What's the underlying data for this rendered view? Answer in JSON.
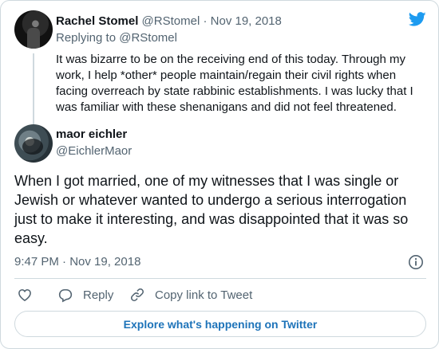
{
  "parent_tweet": {
    "author_name": "Rachel Stomel",
    "author_handle": "@RStomel",
    "separator": "·",
    "date": "Nov 19, 2018",
    "replying_to": "Replying to @RStomel",
    "text": "It was bizarre to be on the receiving end of this today. Through my work, I help *other* people maintain/regain their civil rights when facing overreach by state rabbinic establishments. I was lucky that I was familiar with these shenanigans and did not feel threatened."
  },
  "tweet": {
    "author_name": "maor eichler",
    "author_handle": "@EichlerMaor",
    "text": "When I got married, one of my witnesses that I was single or Jewish or whatever wanted to undergo a serious interrogation just to make it interesting, and was disappointed that it was so easy.",
    "timestamp": "9:47 PM · Nov 19, 2018"
  },
  "actions": {
    "like_icon": "heart-icon",
    "reply_label": "Reply",
    "copy_label": "Copy link to Tweet"
  },
  "explore_button": "Explore what's happening on Twitter",
  "colors": {
    "twitter_blue": "#1d9bf0",
    "link_blue": "#1d73b9",
    "secondary_text": "#536471",
    "border": "#cfd9de"
  }
}
